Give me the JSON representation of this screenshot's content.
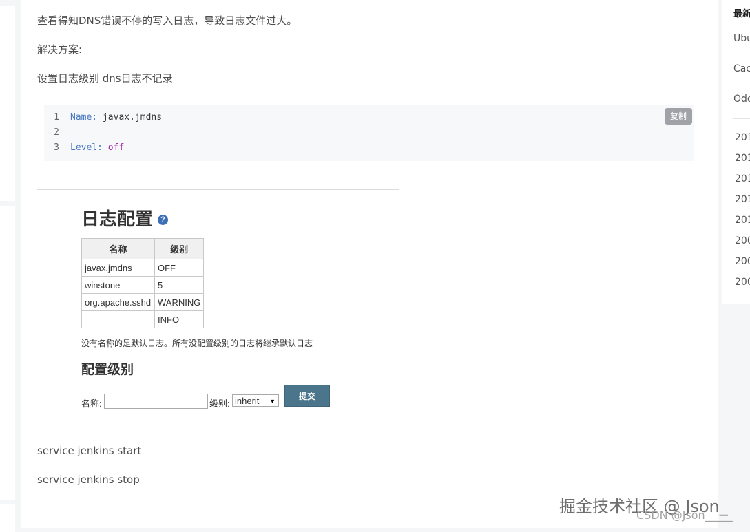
{
  "article": {
    "para1": "查看得知DNS错误不停的写入日志，导致日志文件过大。",
    "para2": "解决方案:",
    "para3": "设置日志级别  dns日志不记录",
    "code": {
      "copy_label": "复制",
      "lines": [
        {
          "num": "1",
          "key": "Name:",
          "value": "javax.jmdns"
        },
        {
          "num": "2",
          "key": "",
          "value": ""
        },
        {
          "num": "3",
          "key": "Level:",
          "value": "off"
        }
      ]
    },
    "cmd_start": "service jenkins start",
    "cmd_stop": "service jenkins stop"
  },
  "log_config": {
    "title": "日志配置",
    "help_icon": "question-circle-icon",
    "table_headers": [
      "名称",
      "级别"
    ],
    "rows": [
      {
        "name": "javax.jmdns",
        "level": "OFF"
      },
      {
        "name": "winstone",
        "level": "5"
      },
      {
        "name": "org.apache.sshd",
        "level": "WARNING"
      },
      {
        "name": "",
        "level": "INFO"
      }
    ],
    "note": "没有名称的是默认日志。所有没配置级别的日志将继承默认日志",
    "form_title": "配置级别",
    "name_label": "名称:",
    "level_label": "级别:",
    "level_value": "inherit",
    "submit_label": "提交"
  },
  "sidebar_right": {
    "title": "最新",
    "items": [
      "Ubu",
      "Cac",
      "Odo"
    ],
    "years": [
      "201",
      "201",
      "201",
      "201",
      "201",
      "200",
      "200",
      "200"
    ]
  },
  "watermark": {
    "main": "掘金技术社区 @ Json_",
    "csdn": "CSDN @Json_____"
  },
  "colors": {
    "code_key": "#4a78c2",
    "code_keyword": "#a626a4",
    "submit_bg": "#4b758b",
    "copy_bg": "#a0a2a8"
  }
}
